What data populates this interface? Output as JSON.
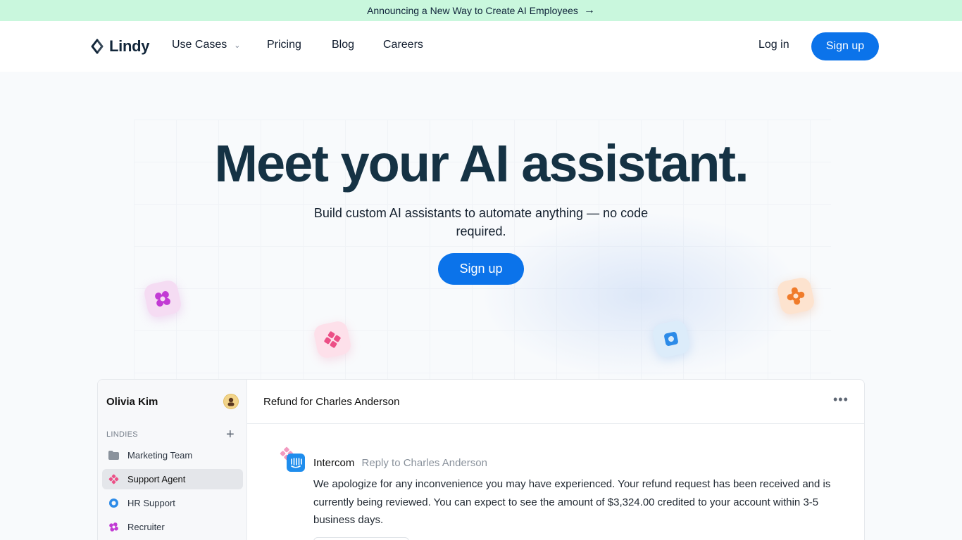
{
  "announcement": {
    "text": "Announcing a New Way to Create AI Employees",
    "arrow": "→"
  },
  "nav": {
    "logo_text": "Lindy",
    "links": [
      "Use Cases",
      "Pricing",
      "Blog",
      "Careers"
    ],
    "use_cases_chevron": "⌄",
    "login": "Log in",
    "signup": "Sign up"
  },
  "hero": {
    "title": "Meet your AI assistant.",
    "subtitle": "Build custom AI assistants to automate anything — no code required.",
    "cta": "Sign up"
  },
  "floating_icons": [
    "purple-flower-icon",
    "pink-clover-icon",
    "blue-square-icon",
    "orange-gear-icon"
  ],
  "app": {
    "user_name": "Olivia Kim",
    "section_label": "LINDIES",
    "add_symbol": "+",
    "items": [
      {
        "label": "Marketing Team",
        "icon": "folder-icon"
      },
      {
        "label": "Support Agent",
        "icon": "pink-clover-icon",
        "active": true
      },
      {
        "label": "HR Support",
        "icon": "blue-ring-icon"
      },
      {
        "label": "Recruiter",
        "icon": "purple-flower-icon"
      }
    ],
    "thread_title": "Refund for Charles Anderson",
    "more_symbol": "•••",
    "message": {
      "source": "Intercom",
      "action": "Reply to Charles Anderson",
      "body": "We apologize for any inconvenience you may have experienced. Your refund request has been received and is currently being reviewed. You can expect to see the amount of $3,324.00 credited to your account within 3-5 business days."
    }
  },
  "colors": {
    "primary": "#0b73ea",
    "announce_bg": "#c9f7dd",
    "title": "#153244"
  }
}
